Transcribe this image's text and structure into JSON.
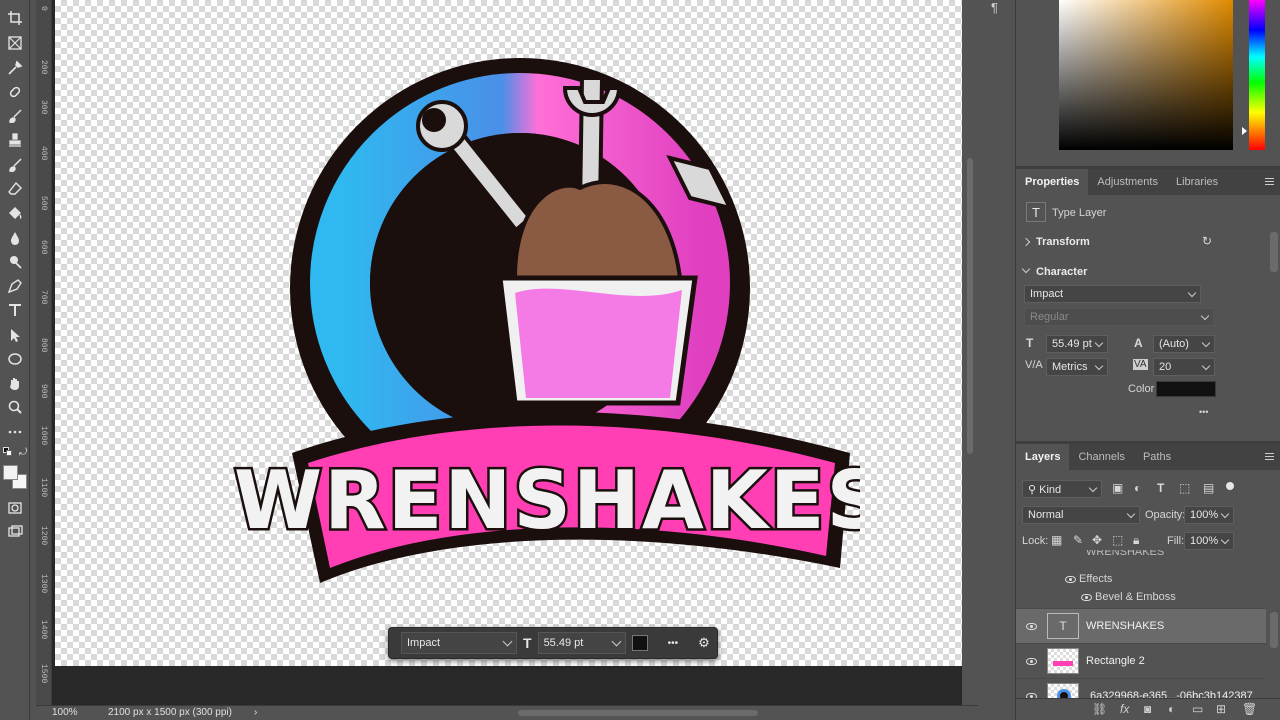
{
  "toolbar": {
    "tools": [
      "crop-icon",
      "frame-icon",
      "eyedropper-icon",
      "healing-brush-icon",
      "brush-icon",
      "clone-stamp-icon",
      "history-brush-icon",
      "eraser-icon",
      "paint-bucket-icon",
      "blur-icon",
      "dodge-icon",
      "pen-icon",
      "type-icon",
      "path-selection-icon",
      "ellipse-icon",
      "hand-icon",
      "zoom-icon",
      "more-tools-icon"
    ]
  },
  "ruler": {
    "marks": [
      "0",
      "200",
      "300",
      "400",
      "500",
      "600",
      "700",
      "800",
      "900",
      "1000",
      "1100",
      "1200",
      "1300",
      "1400",
      "1500"
    ]
  },
  "canvas": {
    "logo_text": "WRENSHAKES"
  },
  "context_bar": {
    "font": "Impact",
    "size": "55.49 pt",
    "more": "•••"
  },
  "status": {
    "zoom": "100%",
    "doc_size": "2100 px x 1500 px (300 ppi)",
    "arrow": "›"
  },
  "properties": {
    "tabs": [
      "Properties",
      "Adjustments",
      "Libraries"
    ],
    "layer_type": "Type Layer",
    "transform_label": "Transform",
    "character_label": "Character",
    "font_family": "Impact",
    "font_style": "Regular",
    "font_size": "55.49 pt",
    "leading": "(Auto)",
    "kerning": "Metrics",
    "tracking": "20",
    "color_label": "Color",
    "color_value": "#111111",
    "more": "•••"
  },
  "layers": {
    "tabs": [
      "Layers",
      "Channels",
      "Paths"
    ],
    "filter": "Kind",
    "blend_mode": "Normal",
    "opacity_label": "Opacity:",
    "opacity": "100%",
    "lock_label": "Lock:",
    "fill_label": "Fill:",
    "fill": "100%",
    "partial_top": "WRENSHAKES",
    "effects_label": "Effects",
    "effect_item": "Bevel & Emboss",
    "rows": [
      {
        "name": "WRENSHAKES",
        "selected": true
      },
      {
        "name": "Rectangle 2",
        "selected": false
      },
      {
        "name": "6a329968-e365...-06bc3b142387",
        "selected": false
      }
    ]
  },
  "colors": {
    "accent_pink": "#ff3fb3",
    "accent_blue": "#2fb9f0",
    "panel_bg": "#535353"
  }
}
